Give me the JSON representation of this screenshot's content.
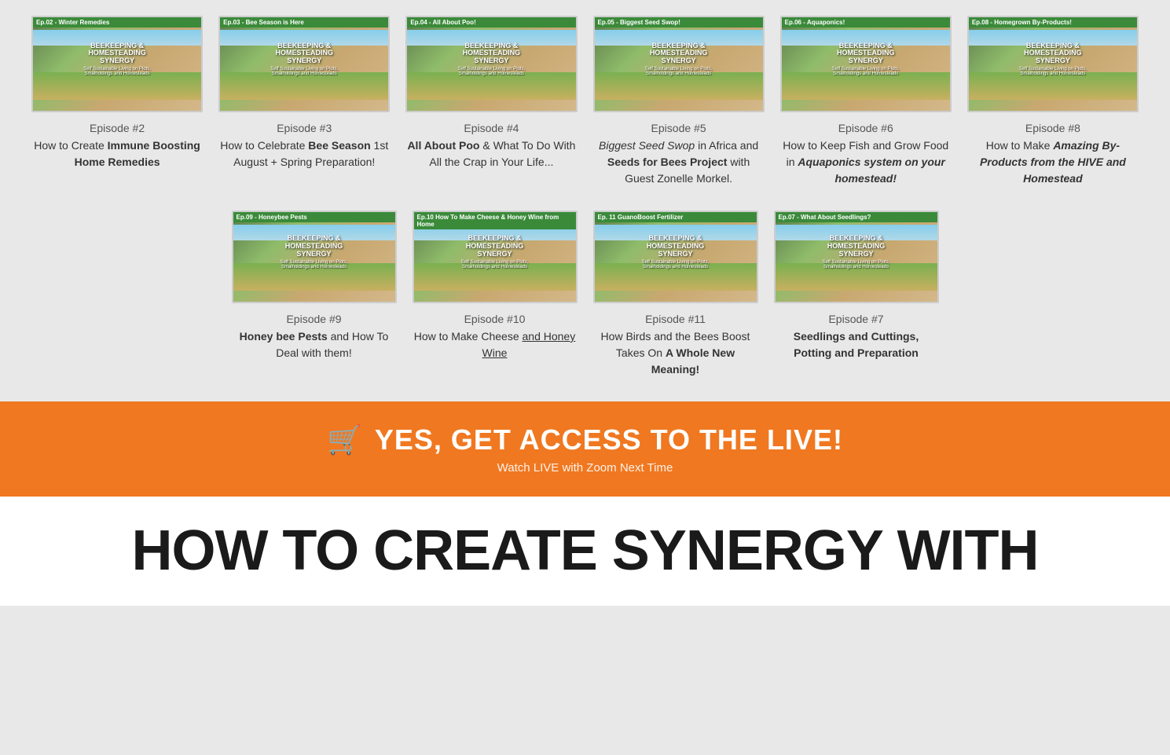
{
  "episodes_top": [
    {
      "id": "ep2",
      "banner": "Ep.02 - Winter Remedies",
      "banner_color": "#3a8a3a",
      "thumb_title": "BEEKEEPING &\nHOMESTEADING\nSYNERGY",
      "thumb_sub": "Self Sustainable Living on Plots,\nSmalholdings and Homesteads",
      "number": "Episode #2",
      "desc_plain": "How to Create ",
      "desc_bold": "Immune Boosting\nHome Remedies"
    },
    {
      "id": "ep3",
      "banner": "Ep.03 - Bee Season is Here",
      "banner_color": "#3a8a3a",
      "thumb_title": "BEEKEEPING &\nHOMESTEADING\nSYNERGY",
      "thumb_sub": "Self Sustainable Living on Plots,\nSmalholdings and Homesteads",
      "number": "Episode #3",
      "desc_plain": "How to Celebrate ",
      "desc_bold": "Bee Season",
      "desc_plain2": " 1st August + Spring Preparation!"
    },
    {
      "id": "ep4",
      "banner": "Ep.04 - All About Poo!",
      "banner_color": "#3a8a3a",
      "thumb_title": "BEEKEEPING &\nHOMESTEADING\nSYNERGY",
      "thumb_sub": "Self Sustainable Living on Plots,\nSmalholdings and Homesteads",
      "number": "Episode #4",
      "desc_bold_prefix": "All About Poo",
      "desc_plain": " & What To Do With All the Crap in Your Life..."
    },
    {
      "id": "ep5",
      "banner": "Ep.05 - Biggest Seed Swop!",
      "banner_color": "#3a8a3a",
      "thumb_title": "BEEKEEPING &\nHOMESTEADING\nSYNERGY",
      "thumb_sub": "Self Sustainable Living on Plots,\nSmalholdings and Homesteads",
      "number": "Episode #5",
      "desc_italic": "Biggest Seed Swop",
      "desc_plain": " in Africa and ",
      "desc_bold": "Seeds for Bees Project",
      "desc_plain2": " with Guest Zonelle Morkel."
    },
    {
      "id": "ep6",
      "banner": "Ep.06 - Aquaponics!",
      "banner_color": "#3a8a3a",
      "thumb_title": "BEEKEEPING &\nHOMESTEADING\nSYNERGY",
      "thumb_sub": "Self Sustainable Living on Plots,\nSmalholdings and Homesteads",
      "number": "Episode #6",
      "desc_plain": "How to Keep Fish and Grow Food in ",
      "desc_italic_bold": "Aquaponics system on your homestead!"
    },
    {
      "id": "ep8",
      "banner": "Ep.08 - Homegrown By-Products!",
      "banner_color": "#3a8a3a",
      "thumb_title": "BEEKEEPING &\nHOMESTEADING\nSYNERGY",
      "thumb_sub": "Self Sustainable Living on Plots,\nSmalholdings and Homesteads",
      "number": "Episode #8",
      "desc_plain": "How to Make ",
      "desc_italic_bold": "Amazing By-Products from the HIVE and Homestead"
    }
  ],
  "episodes_bottom": [
    {
      "id": "ep9",
      "banner": "Ep.09 - Honeybee Pests",
      "banner_color": "#3a8a3a",
      "thumb_title": "BEEKEEPING &\nHOMESTEADING\nSYNERGY",
      "thumb_sub": "Self Sustainable Living on Plots,\nSmalholdings and Homesteads",
      "number": "Episode #9",
      "desc_bold": "Honey bee Pests",
      "desc_plain": " and How To Deal with them!"
    },
    {
      "id": "ep10",
      "banner": "Ep.10 How To Make Cheese & Honey Wine from Home",
      "banner_color": "#3a8a3a",
      "thumb_title": "BEEKEEPING &\nHOMESTEADING\nSYNERGY",
      "thumb_sub": "Self Sustainable Living on Plots,\nSmalholdings and Homesteads",
      "number": "Episode #10",
      "desc_plain": "How to Make Cheese ",
      "desc_underline": "and Honey Wine"
    },
    {
      "id": "ep11",
      "banner": "Ep. 11 GuanoBoost Fertilizer",
      "banner_color": "#3a8a3a",
      "thumb_title": "BEEKEEPING &\nHOMESTEADING\nSYNERGY",
      "thumb_sub": "Self Sustainable Living on Plots,\nSmalholdings and Homesteads",
      "number": "Episode #11",
      "desc_plain": "How Birds and the Bees Boost Takes On ",
      "desc_bold": "A Whole New Meaning!"
    },
    {
      "id": "ep7",
      "banner": "Ep.07 - What About Seedlings?",
      "banner_color": "#3a8a3a",
      "thumb_title": "BEEKEEPING &\nHOMESTEADING\nSYNERGY",
      "thumb_sub": "Self Sustainable Living on Plots,\nSmalholdings and Homesteads",
      "number": "Episode #7",
      "desc_bold": "Seedlings and Cuttings, Potting and Preparation"
    }
  ],
  "cta": {
    "main_text": "YES, GET ACCESS TO THE LIVE!",
    "sub_text": "Watch LIVE with Zoom Next Time",
    "cart_icon": "🛒"
  },
  "bottom_heading": "HOW TO CREATE SYNERGY WITH"
}
